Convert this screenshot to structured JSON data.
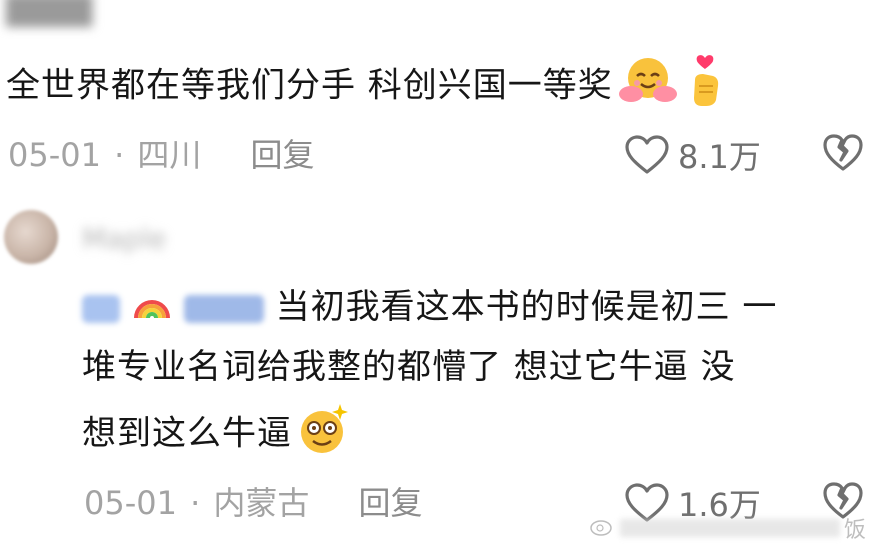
{
  "comment1": {
    "username_blurred": "████",
    "text": "全世界都在等我们分手 科创兴国一等奖",
    "date": "05-01",
    "location": "四川",
    "reply_label": "回复",
    "like_count": "8.1万",
    "emojis": [
      "hug-emoji",
      "finger-heart-emoji"
    ]
  },
  "comment2": {
    "username_blurred": "Maple",
    "prefix_blurred": "██ ███",
    "text_line1": "当初我看这本书的时候是初三 一",
    "text_line2": "堆专业名词给我整的都懵了 想过它牛逼 没",
    "text_line3": "想到这么牛逼",
    "date": "05-01",
    "location": "内蒙古",
    "reply_label": "回复",
    "like_count": "1.6万",
    "emojis": [
      "dizzy-face-emoji",
      "rainbow-emoji"
    ]
  },
  "watermark": {
    "text": "饭"
  },
  "colors": {
    "text": "#161616",
    "meta": "#a3a3a3",
    "icon": "#6f6f6f"
  }
}
